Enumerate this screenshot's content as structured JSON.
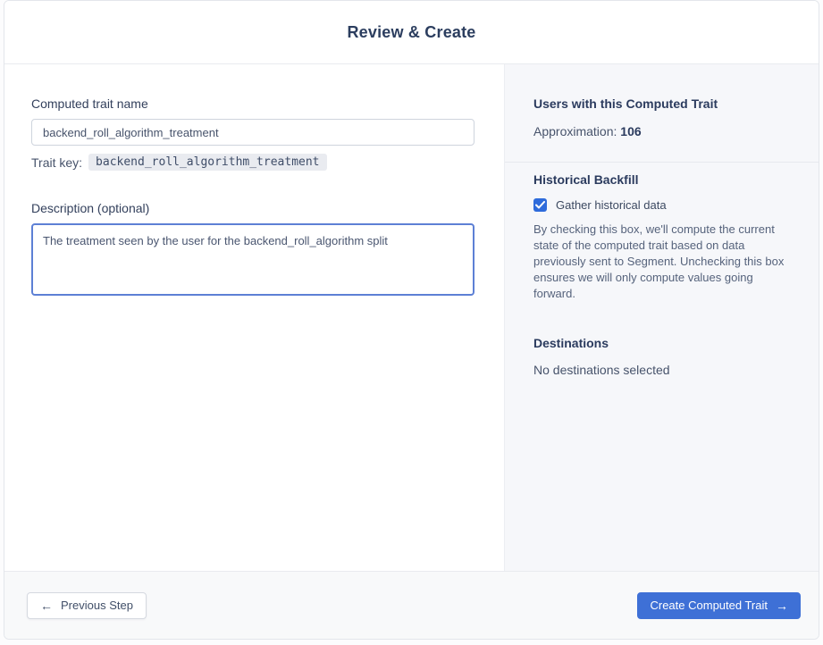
{
  "header": {
    "title": "Review & Create"
  },
  "form": {
    "name_label": "Computed trait name",
    "name_value": "backend_roll_algorithm_treatment",
    "trait_key_label": "Trait key:",
    "trait_key_value": "backend_roll_algorithm_treatment",
    "description_label": "Description (optional)",
    "description_value": "The treatment seen by the user for the backend_roll_algorithm split"
  },
  "summary": {
    "users_heading": "Users with this Computed Trait",
    "approximation_label": "Approximation:",
    "approximation_value": "106",
    "backfill_heading": "Historical Backfill",
    "backfill_checkbox_label": "Gather historical data",
    "backfill_checkbox_checked": true,
    "backfill_description": "By checking this box, we'll compute the current state of the computed trait based on data previously sent to Segment. Unchecking this box ensures we will only compute values going forward.",
    "destinations_heading": "Destinations",
    "destinations_value": "No destinations selected"
  },
  "footer": {
    "previous_icon": "←",
    "previous_label": "Previous Step",
    "create_label": "Create Computed Trait",
    "create_icon": "→"
  },
  "colors": {
    "primary_blue": "#3e70d6",
    "checkbox_blue": "#2e6bdb",
    "heading_text": "#2b3b5e",
    "panel_background": "#f6f7fa"
  }
}
